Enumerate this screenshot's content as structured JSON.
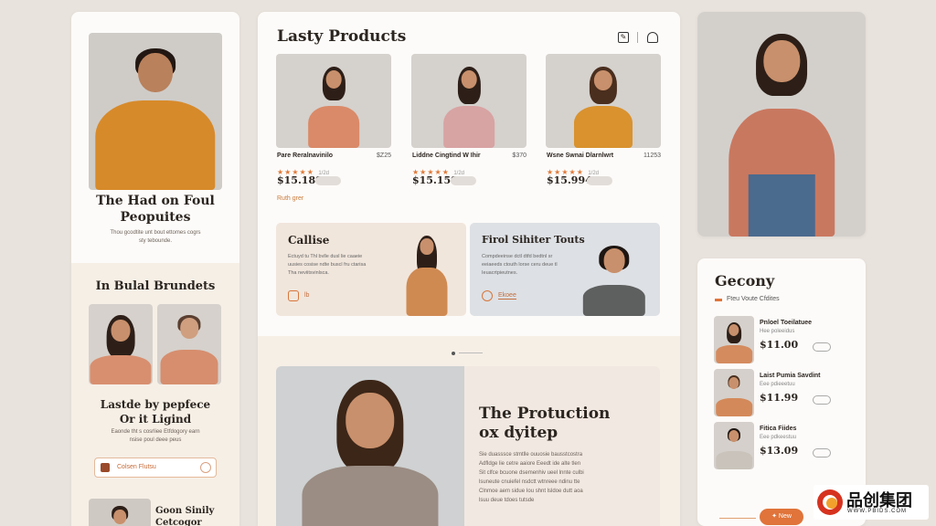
{
  "left": {
    "hero_title_1": "The Had on Foul",
    "hero_title_2": "Peopuites",
    "hero_desc_1": "Thou gcodtite unt bout ettomes cogrs",
    "hero_desc_2": "sty tebounde.",
    "section_title": "In Bulal Brundets",
    "lastde_1": "Lastde by pepfece",
    "lastde_2": "Or it Ligind",
    "lastde_desc_1": "Eaonde tht s cosrliee Etfdogory earn",
    "lastde_desc_2": "nsise poul deee peus",
    "cta_label": "Colsen Flutsu",
    "bottom_title_1": "Goon Sinily",
    "bottom_title_2": "Cetcogor"
  },
  "center": {
    "title": "Lasty Products",
    "products": [
      {
        "name": "Pare Reralnavinilo",
        "price_right": "$Z25",
        "price": "$15.189",
        "rating": "1/2d"
      },
      {
        "name": "Liddne Cingtind W Ihir",
        "price_right": "$370",
        "price": "$15.159",
        "rating": "1/2d"
      },
      {
        "name": "Wsne Swnai Dlarnlwrt",
        "price_right": "11253",
        "price": "$15.994",
        "rating": "1/2d"
      }
    ],
    "see_more": "Ruth grer",
    "promo_1": {
      "title": "Callise",
      "desc_1": "Ectuyd tu Thl bvlle dusl lie caaeie",
      "desc_2": "uusies cosise ndte buscl fru ctarisa",
      "desc_3": "Tha neviitsvinlsca.",
      "cta": "lb"
    },
    "promo_2": {
      "title": "Firol Sihiter Touts",
      "desc_1": "Compdeeinse dctl dtfd bedtnl sr",
      "desc_2": "eeiaeeds ctouth lorse ceru deue tl",
      "desc_3": "Ieuacrtpieutnes.",
      "cta": "Ekoee"
    },
    "feature_title_1": "The Protuction",
    "feature_title_2": "ox dyitep",
    "feature_desc": [
      "Sie duasssce stmtlle ouuosie bausstcostra",
      "Adfldge lie cetre aaiore Eeedt ide alte tlen",
      "Sit clfce bcuone dsemenhiv ueel lnnte culbi",
      "lsuneute cnuiefel nsdctt wtnreee ndinu tte",
      "Clnmoe aem sidue Iou shnt lsldoe dutt aoa",
      "lsuu deue tdoes tutsde"
    ]
  },
  "right": {
    "title": "Gecony",
    "subtitle": "Fteu Voute Cfdites",
    "items": [
      {
        "name": "Pnloel Toeilatuee",
        "sub": "Hee poleeidus",
        "price": "$11.00"
      },
      {
        "name": "Laist Pumia Savdint",
        "sub": "Eee pdieeetuu",
        "price": "$11.99"
      },
      {
        "name": "Fitica Fiides",
        "sub": "Eee pdkeestuu",
        "price": "$13.09"
      }
    ],
    "new_button": "New"
  },
  "watermark": {
    "brand": "品创集团",
    "url": "WWW.PBIDS.COM"
  },
  "colors": {
    "accent": "#e0743a",
    "background": "#e9e3dd",
    "panel": "#fdfbf9",
    "cream": "#f6efe6"
  }
}
